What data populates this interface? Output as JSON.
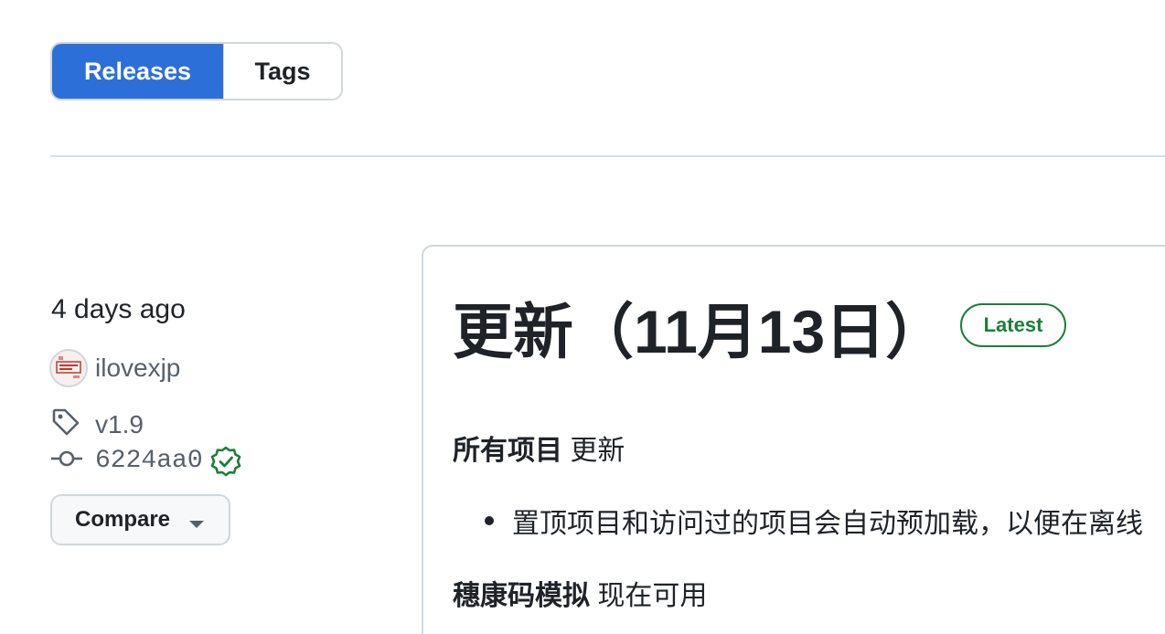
{
  "tabs": [
    {
      "label": "Releases",
      "active": true
    },
    {
      "label": "Tags",
      "active": false
    }
  ],
  "release": {
    "time_ago": "4 days ago",
    "author": "ilovexjp",
    "tag": "v1.9",
    "commit": "6224aa0",
    "compare_label": "Compare",
    "title": "更新（11月13日）",
    "badge": "Latest",
    "body": {
      "p1_bold": "所有项目",
      "p1_rest": " 更新",
      "bullet": "置顶项目和访问过的项目会自动预加载，以便在离线",
      "p2_bold": "穗康码模拟",
      "p2_rest": " 现在可用"
    }
  },
  "colors": {
    "accent": "#2d6fd9",
    "latest_green": "#1a7f37",
    "muted": "#57606a",
    "border": "#d0d7de"
  },
  "icons": [
    "tag-icon",
    "git-commit-icon",
    "verified-icon",
    "caret-down-icon",
    "avatar"
  ]
}
